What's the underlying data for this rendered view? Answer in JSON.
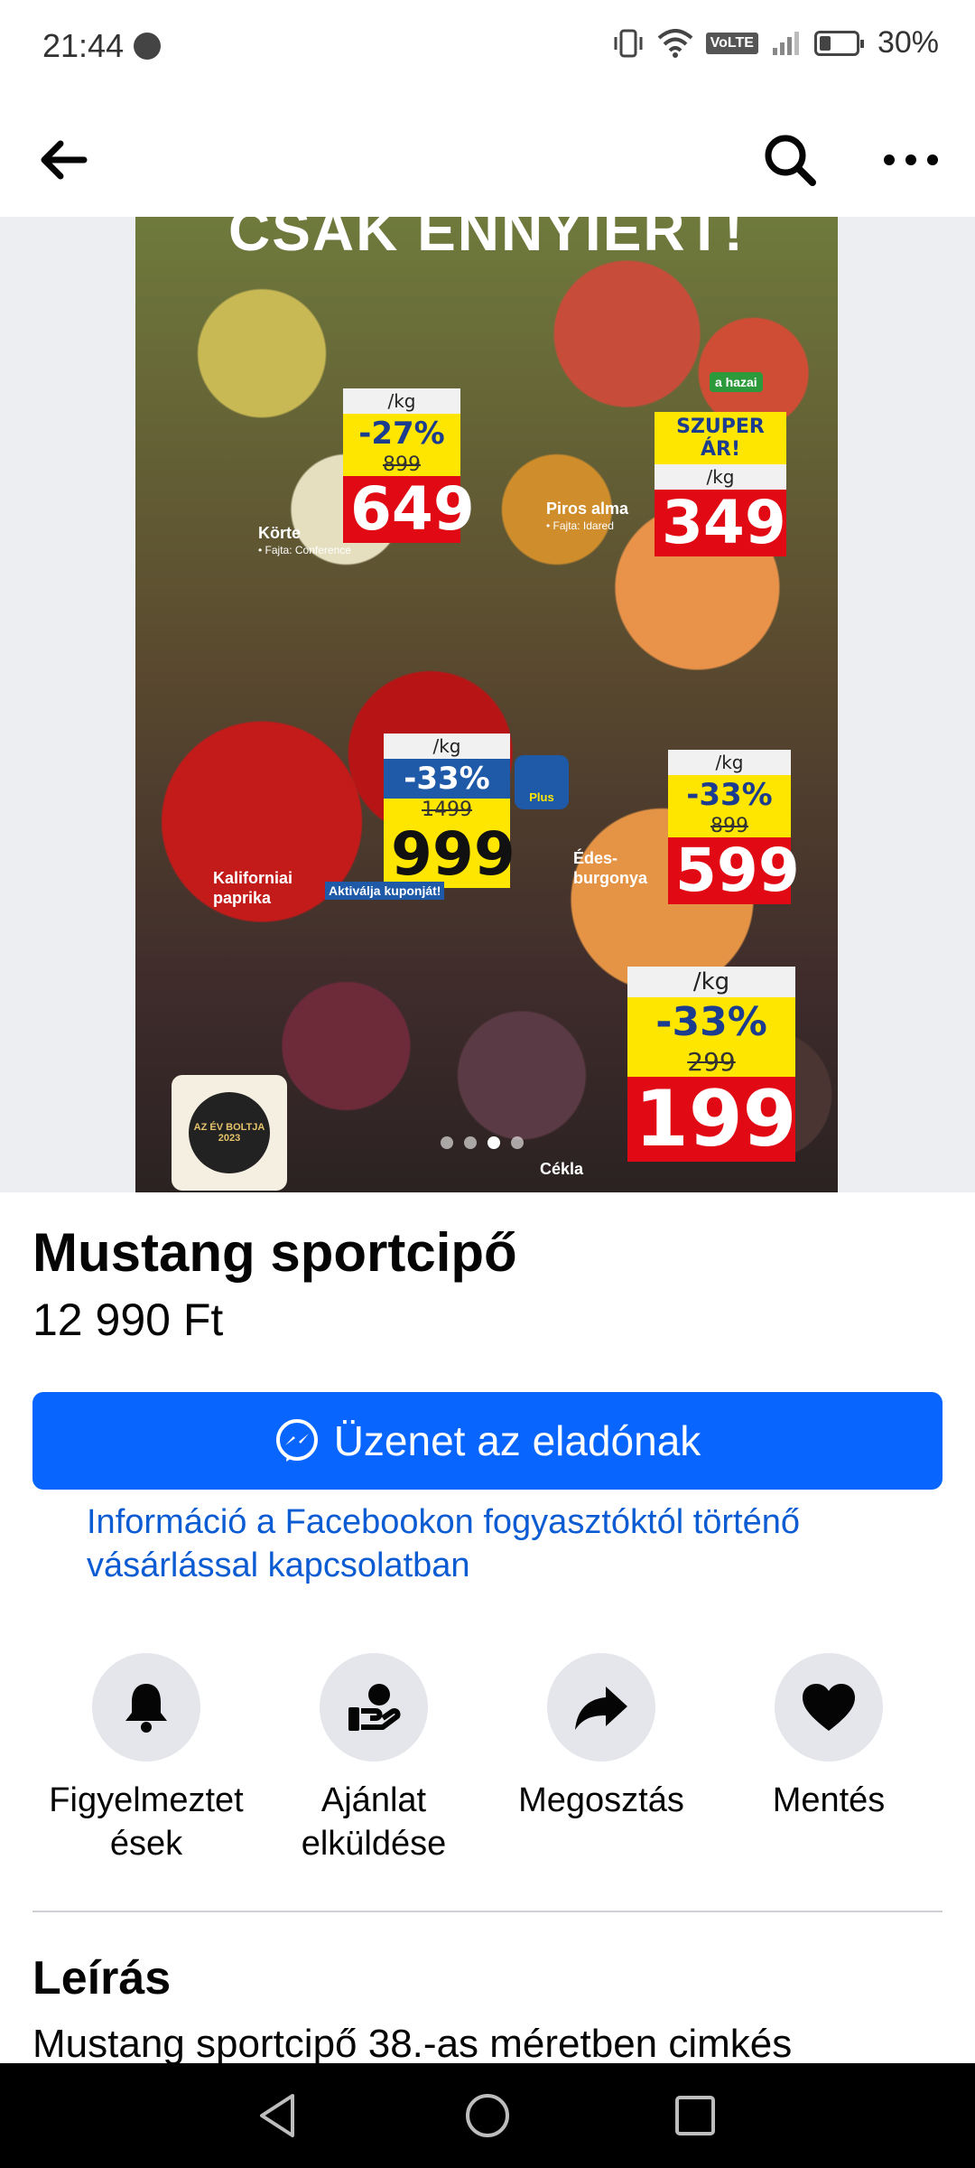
{
  "status_bar": {
    "time": "21:44",
    "battery": "30%",
    "volte": "VoLTE",
    "icons": [
      "messenger-icon",
      "vibrate-icon",
      "wifi-icon",
      "signal-icon",
      "battery-icon"
    ]
  },
  "app_bar": {
    "back_icon": "arrow-left-icon",
    "search_icon": "search-icon",
    "more_icon": "more-icon"
  },
  "image": {
    "flyer_heading": "CSAK ENNYIÉRT!",
    "products": [
      {
        "name": "Körte",
        "sub": "• Fajta: Conference",
        "unit": "/kg",
        "discount": "-27%",
        "old_price": "899",
        "price": "649"
      },
      {
        "name": "Piros alma",
        "sub": "• Fajta: Idared",
        "badge": "SZUPER ÁR!",
        "unit": "/kg",
        "price": "349"
      },
      {
        "name": "Kaliforniai paprika",
        "unit": "/kg",
        "discount": "-33%",
        "old_price": "1499",
        "price": "999",
        "coupon": "Aktiválja kuponját!",
        "plus": "Plus"
      },
      {
        "name": "Édes-burgonya",
        "unit": "/kg",
        "discount": "-33%",
        "old_price": "899",
        "price": "599"
      },
      {
        "name": "Cékla",
        "unit": "/kg",
        "discount": "-33%",
        "old_price": "299",
        "price": "199"
      }
    ],
    "hazai_label": "a hazai",
    "badge_text": "AZ ÉV BOLTJA 2023",
    "pager": {
      "count": 4,
      "active": 3
    }
  },
  "listing": {
    "title": "Mustang sportcipő",
    "price": "12 990 Ft",
    "message_button": "Üzenet az eladónak",
    "info_link": "Információ a Facebookon fogyasztóktól történő vásárlással kapcsolatban"
  },
  "actions": [
    {
      "label": "Figyelmeztet ések",
      "icon": "bell-icon"
    },
    {
      "label": "Ajánlat elküldése",
      "icon": "offer-icon"
    },
    {
      "label": "Megosztás",
      "icon": "share-icon"
    },
    {
      "label": "Mentés",
      "icon": "heart-icon"
    }
  ],
  "description": {
    "heading": "Leírás",
    "text": "Mustang sportcipő 38.-as méretben cimkés"
  },
  "nav_bar": {
    "icons": [
      "back-triangle-icon",
      "home-circle-icon",
      "recents-square-icon"
    ]
  }
}
